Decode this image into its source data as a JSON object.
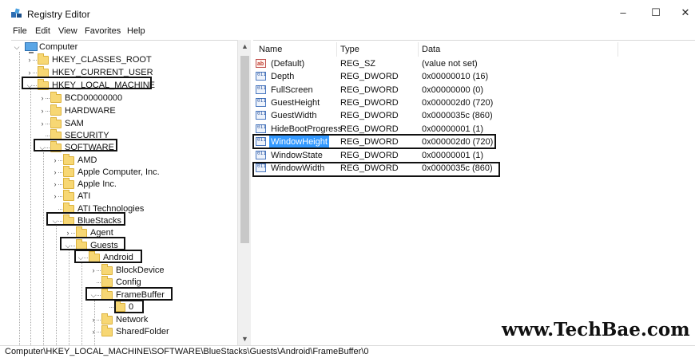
{
  "window": {
    "title": "Registry Editor",
    "minimize": "–",
    "maximize": "☐",
    "close": "✕"
  },
  "menu": [
    "File",
    "Edit",
    "View",
    "Favorites",
    "Help"
  ],
  "tree": [
    {
      "label": "Computer",
      "expander": "⌵"
    },
    {
      "label": "HKEY_CLASSES_ROOT",
      "expander": "›"
    },
    {
      "label": "HKEY_CURRENT_USER",
      "expander": "›"
    },
    {
      "label": "HKEY_LOCAL_MACHINE",
      "expander": "⌵"
    },
    {
      "label": "BCD00000000",
      "expander": "›"
    },
    {
      "label": "HARDWARE",
      "expander": "›"
    },
    {
      "label": "SAM",
      "expander": "›"
    },
    {
      "label": "SECURITY",
      "expander": ""
    },
    {
      "label": "SOFTWARE",
      "expander": "⌵"
    },
    {
      "label": "AMD",
      "expander": "›"
    },
    {
      "label": "Apple Computer, Inc.",
      "expander": "›"
    },
    {
      "label": "Apple Inc.",
      "expander": "›"
    },
    {
      "label": "ATI",
      "expander": "›"
    },
    {
      "label": "ATI Technologies",
      "expander": ""
    },
    {
      "label": "BlueStacks",
      "expander": "⌵"
    },
    {
      "label": "Agent",
      "expander": "›"
    },
    {
      "label": "Guests",
      "expander": "⌵"
    },
    {
      "label": "Android",
      "expander": "⌵"
    },
    {
      "label": "BlockDevice",
      "expander": "›"
    },
    {
      "label": "Config",
      "expander": ""
    },
    {
      "label": "FrameBuffer",
      "expander": "⌵"
    },
    {
      "label": "0",
      "expander": ""
    },
    {
      "label": "Network",
      "expander": "›"
    },
    {
      "label": "SharedFolder",
      "expander": "›"
    }
  ],
  "columns": {
    "name": "Name",
    "type": "Type",
    "data": "Data"
  },
  "values": [
    {
      "name": "(Default)",
      "type": "REG_SZ",
      "data": "(value not set)",
      "icon": "ab"
    },
    {
      "name": "Depth",
      "type": "REG_DWORD",
      "data": "0x00000010 (16)",
      "icon": "011"
    },
    {
      "name": "FullScreen",
      "type": "REG_DWORD",
      "data": "0x00000000 (0)",
      "icon": "011"
    },
    {
      "name": "GuestHeight",
      "type": "REG_DWORD",
      "data": "0x000002d0 (720)",
      "icon": "011"
    },
    {
      "name": "GuestWidth",
      "type": "REG_DWORD",
      "data": "0x0000035c (860)",
      "icon": "011"
    },
    {
      "name": "HideBootProgress",
      "type": "REG_DWORD",
      "data": "0x00000001 (1)",
      "icon": "011"
    },
    {
      "name": "WindowHeight",
      "type": "REG_DWORD",
      "data": "0x000002d0 (720)",
      "icon": "011"
    },
    {
      "name": "WindowState",
      "type": "REG_DWORD",
      "data": "0x00000001 (1)",
      "icon": "011"
    },
    {
      "name": "WindowWidth",
      "type": "REG_DWORD",
      "data": "0x0000035c (860)",
      "icon": "011"
    }
  ],
  "status": "Computer\\HKEY_LOCAL_MACHINE\\SOFTWARE\\BlueStacks\\Guests\\Android\\FrameBuffer\\0",
  "watermark": "www.TechBae.com",
  "colors": {
    "selection": "#3399ff",
    "folder": "#f7d774",
    "highlight_box": "#111111"
  }
}
